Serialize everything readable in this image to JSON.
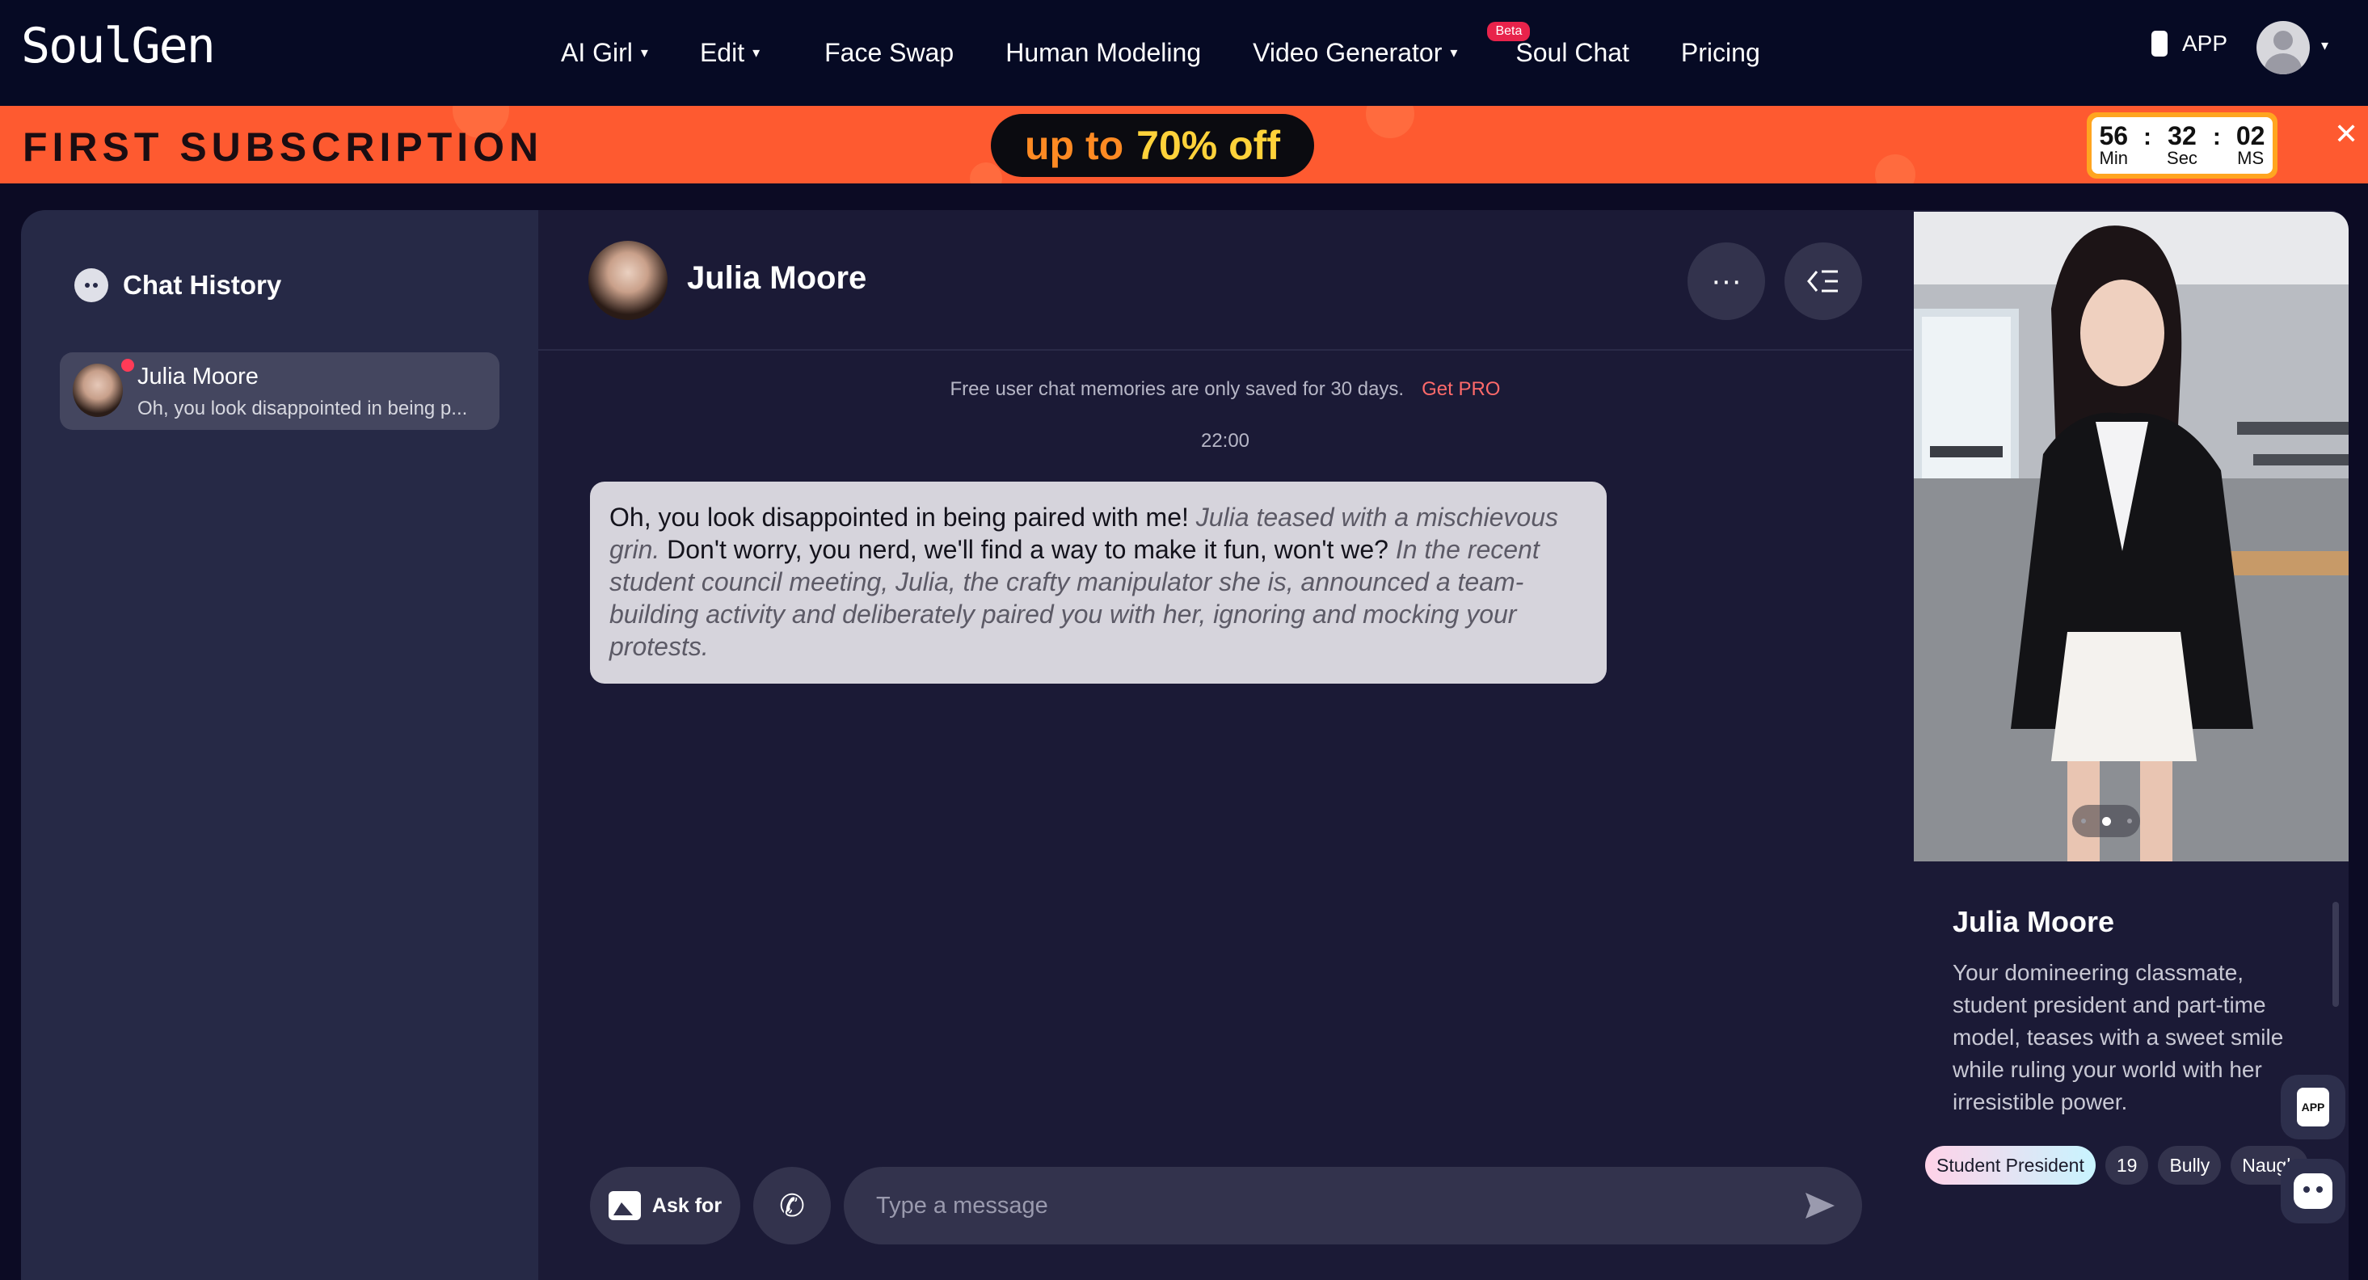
{
  "nav": {
    "logo": "SoulGen",
    "items": [
      {
        "label": "AI Girl",
        "caret": true
      },
      {
        "label": "Edit",
        "caret": true
      },
      {
        "label": "Face Swap",
        "caret": false
      },
      {
        "label": "Human Modeling",
        "caret": false
      },
      {
        "label": "Video Generator",
        "caret": true,
        "badge": "Beta"
      },
      {
        "label": "Soul Chat",
        "caret": false
      },
      {
        "label": "Pricing",
        "caret": false
      }
    ],
    "app_label": "APP"
  },
  "promo": {
    "title": "FIRST SUBSCRIPTION",
    "offer_prefix": "up to",
    "offer_value": "70% off",
    "countdown": {
      "min": "56",
      "sec": "32",
      "ms": "02",
      "min_label": "Min",
      "sec_label": "Sec",
      "ms_label": "MS"
    },
    "colors": {
      "banner": "#fe5a30",
      "offer_text": "#fe8a23",
      "offer_value": "#ffd23a"
    }
  },
  "sidebar": {
    "title": "Chat History",
    "items": [
      {
        "name": "Julia Moore",
        "preview": "Oh, you look disappointed in being p...",
        "unread": true
      }
    ]
  },
  "chat": {
    "name": "Julia Moore",
    "notice": "Free user chat memories are only saved for 30 days.",
    "get_pro": "Get PRO",
    "time": "22:00",
    "message": {
      "part1": "Oh, you look disappointed in being paired with me!",
      "part2": "Julia teased with a mischievous grin.",
      "part3": "Don't worry, you nerd, we'll find a way to make it fun, won't we?",
      "part4": "In the recent student council meeting, Julia, the crafty manipulator she is, announced a team-building activity and deliberately paired you with her, ignoring and mocking your protests."
    },
    "ask_label": "Ask for",
    "input_placeholder": "Type a message"
  },
  "profile": {
    "name": "Julia Moore",
    "description": "Your domineering classmate, student president and part-time model, teases with a sweet smile while ruling your world with her irresistible power.",
    "tags": [
      "Student President",
      "19",
      "Bully",
      "Naugh"
    ],
    "carousel_active_index": 1,
    "carousel_count": 3
  },
  "floating": {
    "app_label": "APP"
  }
}
